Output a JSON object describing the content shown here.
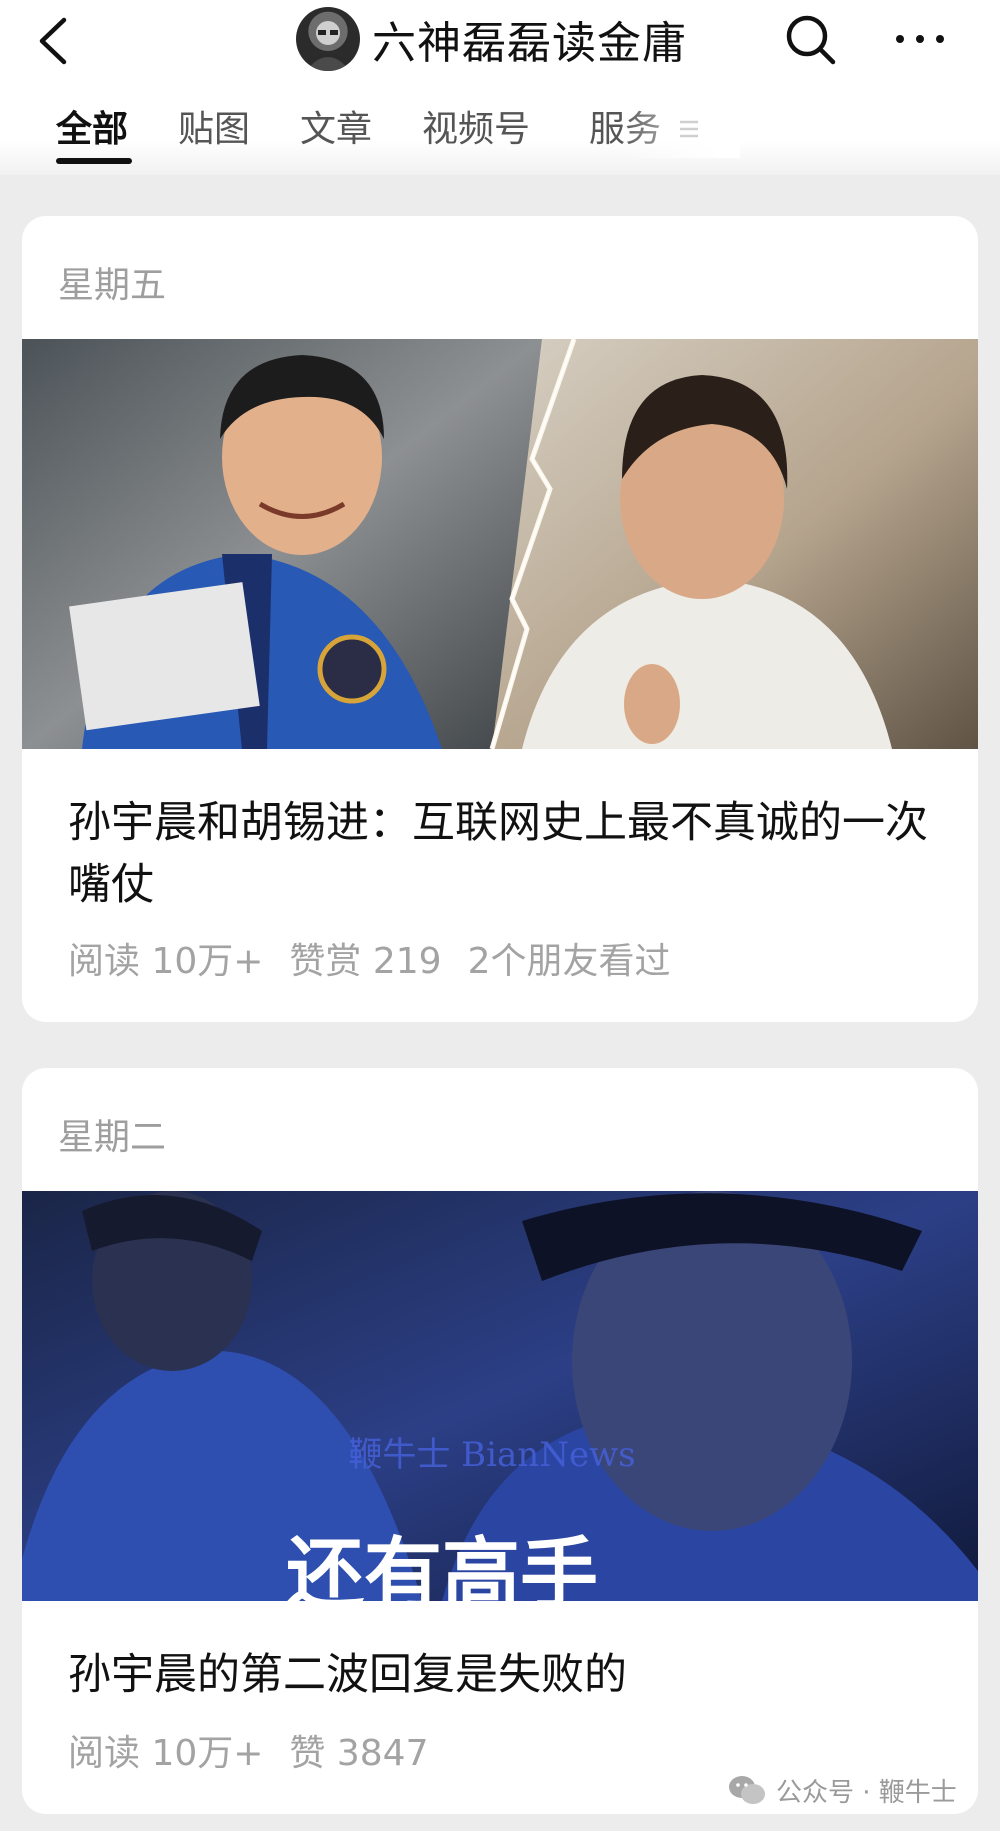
{
  "header": {
    "account_name": "六神磊磊读金庸"
  },
  "tabs": [
    {
      "label": "全部",
      "active": true
    },
    {
      "label": "贴图",
      "active": false
    },
    {
      "label": "文章",
      "active": false
    },
    {
      "label": "视频号",
      "active": false
    },
    {
      "label": "服务",
      "active": false
    }
  ],
  "articles": [
    {
      "date": "星期五",
      "title": "孙宇晨和胡锡进：互联网史上最不真诚的一次嘴仗",
      "stats": [
        "阅读 10万+",
        "赞赏 219",
        "2个朋友看过"
      ]
    },
    {
      "date": "星期二",
      "title": "孙宇晨的第二波回复是失败的",
      "stats": [
        "阅读 10万+",
        "赞 3847"
      ],
      "cover_text": "还有高手",
      "cover_watermark": "鞭牛士 BianNews"
    }
  ],
  "watermark": {
    "text": "公众号 · 鞭牛士",
    "icon": "wechat-icon"
  },
  "colors": {
    "background": "#ececec",
    "card": "#ffffff",
    "muted_text": "#9e9e9e",
    "cover_blue": "#2a3f8f"
  }
}
